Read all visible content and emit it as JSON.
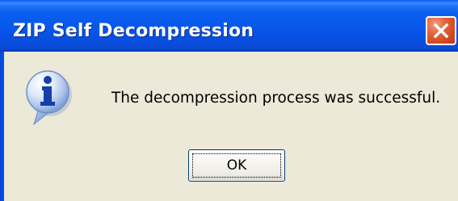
{
  "window": {
    "title": "ZIP Self Decompression"
  },
  "titlebar": {
    "close_icon": "close-icon",
    "colors": {
      "title_bar": "#0858ec",
      "close_button": "#d34a20",
      "title_text": "#ffffff"
    }
  },
  "dialog": {
    "icon": "information-icon",
    "message": "The decompression process was successful.",
    "ok_label": "OK",
    "background": "#ece9d8"
  }
}
